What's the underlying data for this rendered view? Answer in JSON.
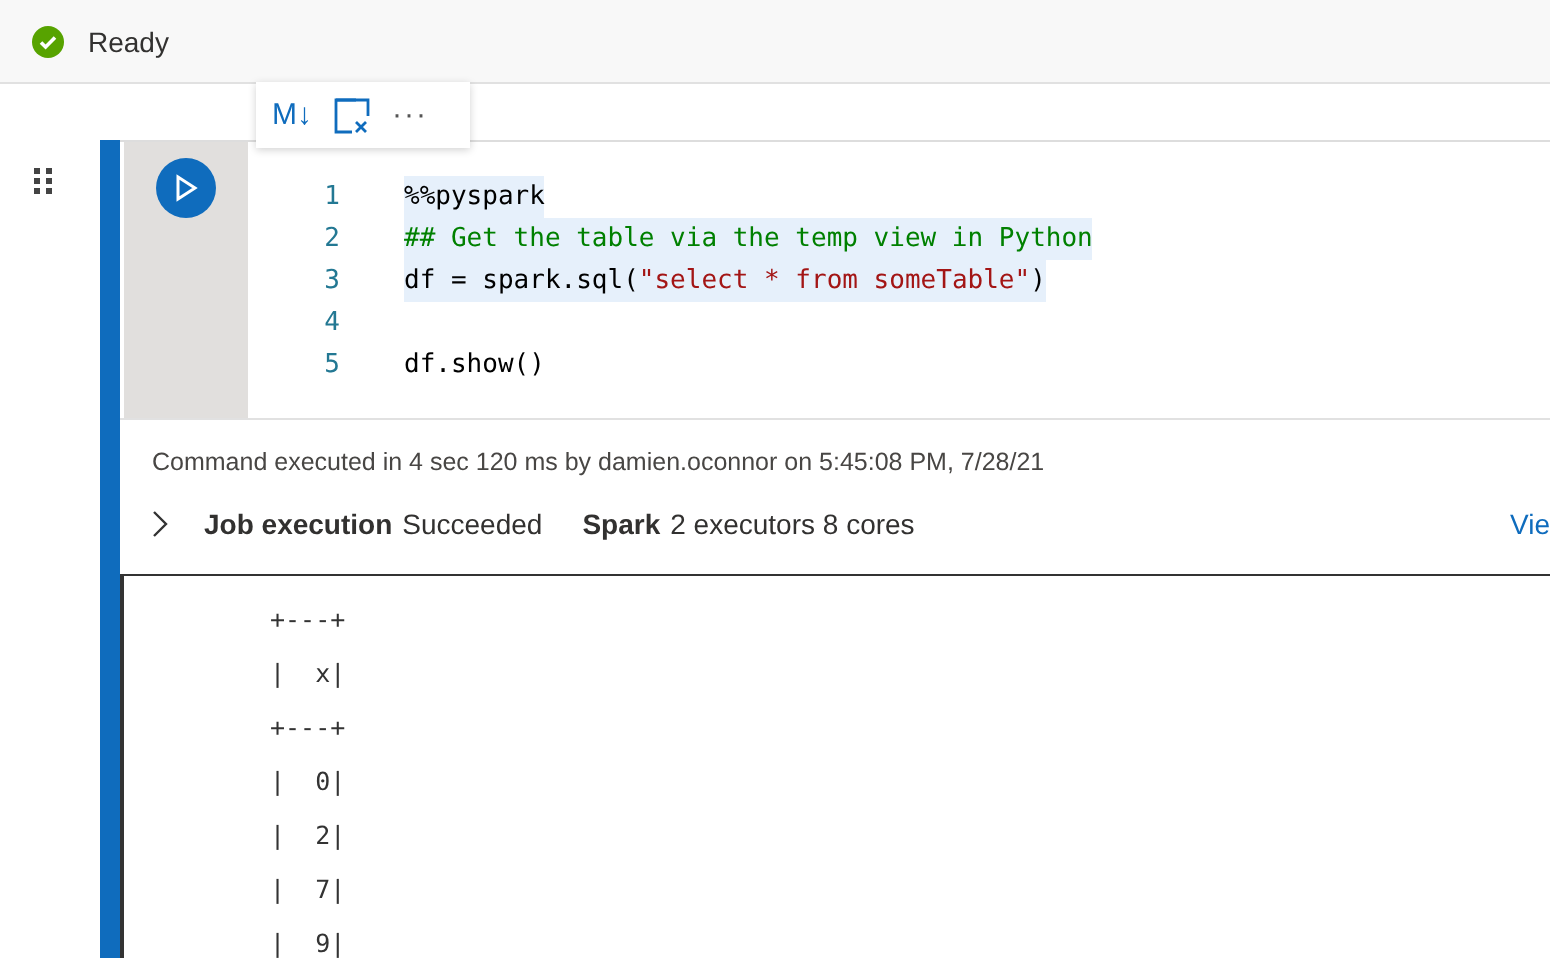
{
  "status": {
    "text": "Ready"
  },
  "toolbar": {
    "markdown_label": "M↓",
    "more_label": "···"
  },
  "cell": {
    "selected": true,
    "code": [
      {
        "number": "1",
        "highlighted": true,
        "tokens": [
          {
            "text": "%%pyspark",
            "kind": "plain"
          }
        ]
      },
      {
        "number": "2",
        "highlighted": true,
        "tokens": [
          {
            "text": "## Get the table via the temp view in Python",
            "kind": "comment"
          }
        ]
      },
      {
        "number": "3",
        "highlighted": true,
        "tokens": [
          {
            "text": "df = spark.sql(",
            "kind": "plain"
          },
          {
            "text": "\"select * from someTable\"",
            "kind": "string"
          },
          {
            "text": ")",
            "kind": "plain"
          }
        ]
      },
      {
        "number": "4",
        "highlighted": false
      },
      {
        "number": "5",
        "highlighted": false,
        "tokens": [
          {
            "text": "df.show()",
            "kind": "plain"
          }
        ]
      }
    ],
    "execution_info": "Command executed in 4 sec 120 ms by damien.oconnor on 5:45:08 PM, 7/28/21",
    "job": {
      "label": "Job execution",
      "status": "Succeeded",
      "spark_label": "Spark",
      "spark_detail": "2 executors 8 cores",
      "link": "Vie"
    },
    "output": [
      "+---+",
      "|  x|",
      "+---+",
      "|  0|",
      "|  2|",
      "|  7|",
      "|  9|"
    ]
  }
}
